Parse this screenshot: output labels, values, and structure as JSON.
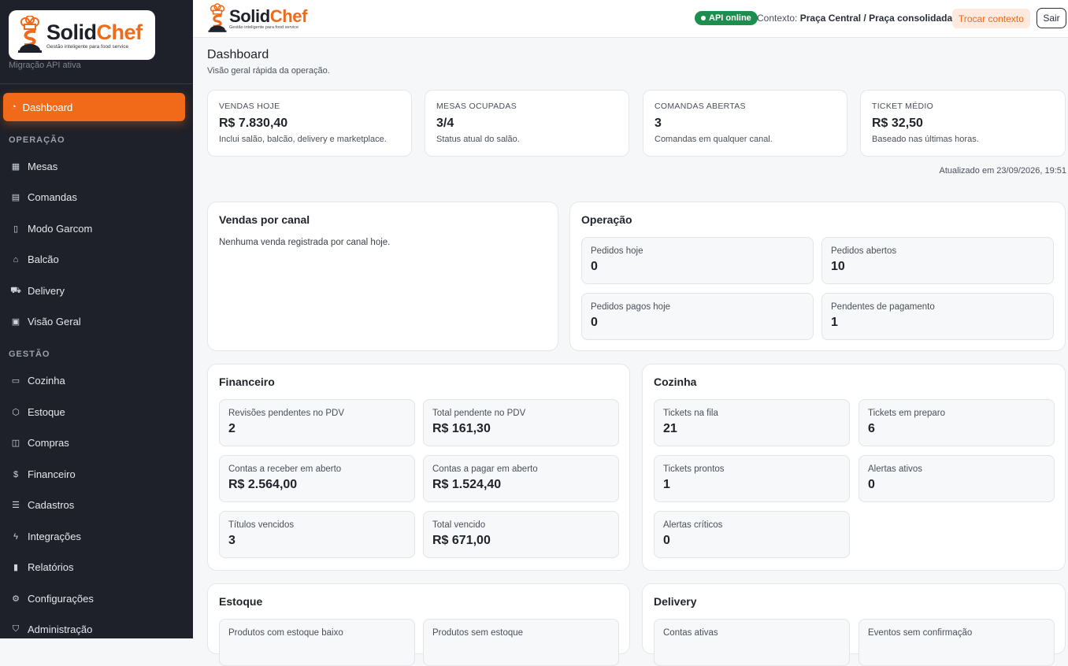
{
  "brand": {
    "name_a": "Solid",
    "name_b": "Chef",
    "tagline": "Gestão inteligente para food service",
    "status": "Migração API ativa"
  },
  "nav": {
    "active": {
      "icon": "dashboard-icon",
      "label": "Dashboard"
    },
    "section_operacao": "OPERAÇÃO",
    "operacao": [
      {
        "icon": "grid-icon",
        "label": "Mesas"
      },
      {
        "icon": "receipt-icon",
        "label": "Comandas"
      },
      {
        "icon": "phone-icon",
        "label": "Modo Garcom"
      },
      {
        "icon": "store-icon",
        "label": "Balcão"
      },
      {
        "icon": "truck-icon",
        "label": "Delivery"
      },
      {
        "icon": "overview-icon",
        "label": "Visão Geral"
      }
    ],
    "section_gestao": "GESTÃO",
    "gestao": [
      {
        "icon": "monitor-icon",
        "label": "Cozinha"
      },
      {
        "icon": "box-icon",
        "label": "Estoque"
      },
      {
        "icon": "bag-icon",
        "label": "Compras"
      },
      {
        "icon": "money-icon",
        "label": "Financeiro"
      },
      {
        "icon": "list-icon",
        "label": "Cadastros"
      },
      {
        "icon": "plug-icon",
        "label": "Integrações"
      },
      {
        "icon": "chart-icon",
        "label": "Relatórios"
      },
      {
        "icon": "gear-icon",
        "label": "Configurações"
      },
      {
        "icon": "shield-icon",
        "label": "Administração"
      }
    ]
  },
  "topbar": {
    "api": "API online",
    "ctx_label": "Contexto:",
    "ctx_value": "Praça Central / Praça consolidada",
    "switch": "Trocar contexto",
    "logout": "Sair"
  },
  "page": {
    "title": "Dashboard",
    "subtitle": "Visão geral rápida da operação.",
    "updated": "Atualizado em 23/09/2026, 19:51"
  },
  "kpis": [
    {
      "label": "VENDAS HOJE",
      "value": "R$ 7.830,40",
      "desc": "Inclui salão, balcão, delivery e marketplace."
    },
    {
      "label": "MESAS OCUPADAS",
      "value": "3/4",
      "desc": "Status atual do salão."
    },
    {
      "label": "COMANDAS ABERTAS",
      "value": "3",
      "desc": "Comandas em qualquer canal."
    },
    {
      "label": "TICKET MÉDIO",
      "value": "R$ 32,50",
      "desc": "Baseado nas últimas horas."
    }
  ],
  "vendas": {
    "title": "Vendas por canal",
    "empty": "Nenhuma venda registrada por canal hoje."
  },
  "operacao": {
    "title": "Operação",
    "stats": [
      {
        "label": "Pedidos hoje",
        "value": "0"
      },
      {
        "label": "Pedidos abertos",
        "value": "10"
      },
      {
        "label": "Pedidos pagos hoje",
        "value": "0"
      },
      {
        "label": "Pendentes de pagamento",
        "value": "1"
      }
    ]
  },
  "financeiro": {
    "title": "Financeiro",
    "stats": [
      {
        "label": "Revisões pendentes no PDV",
        "value": "2"
      },
      {
        "label": "Total pendente no PDV",
        "value": "R$ 161,30"
      },
      {
        "label": "Contas a receber em aberto",
        "value": "R$ 2.564,00"
      },
      {
        "label": "Contas a pagar em aberto",
        "value": "R$ 1.524,40"
      },
      {
        "label": "Títulos vencidos",
        "value": "3"
      },
      {
        "label": "Total vencido",
        "value": "R$ 671,00"
      }
    ]
  },
  "cozinha": {
    "title": "Cozinha",
    "stats": [
      {
        "label": "Tickets na fila",
        "value": "21"
      },
      {
        "label": "Tickets em preparo",
        "value": "6"
      },
      {
        "label": "Tickets prontos",
        "value": "1"
      },
      {
        "label": "Alertas ativos",
        "value": "0"
      },
      {
        "label": "Alertas críticos",
        "value": "0"
      }
    ]
  },
  "estoque": {
    "title": "Estoque",
    "stats": [
      {
        "label": "Produtos com estoque baixo"
      },
      {
        "label": "Produtos sem estoque"
      }
    ]
  },
  "delivery": {
    "title": "Delivery",
    "stats": [
      {
        "label": "Contas ativas"
      },
      {
        "label": "Eventos sem confirmação"
      }
    ]
  }
}
